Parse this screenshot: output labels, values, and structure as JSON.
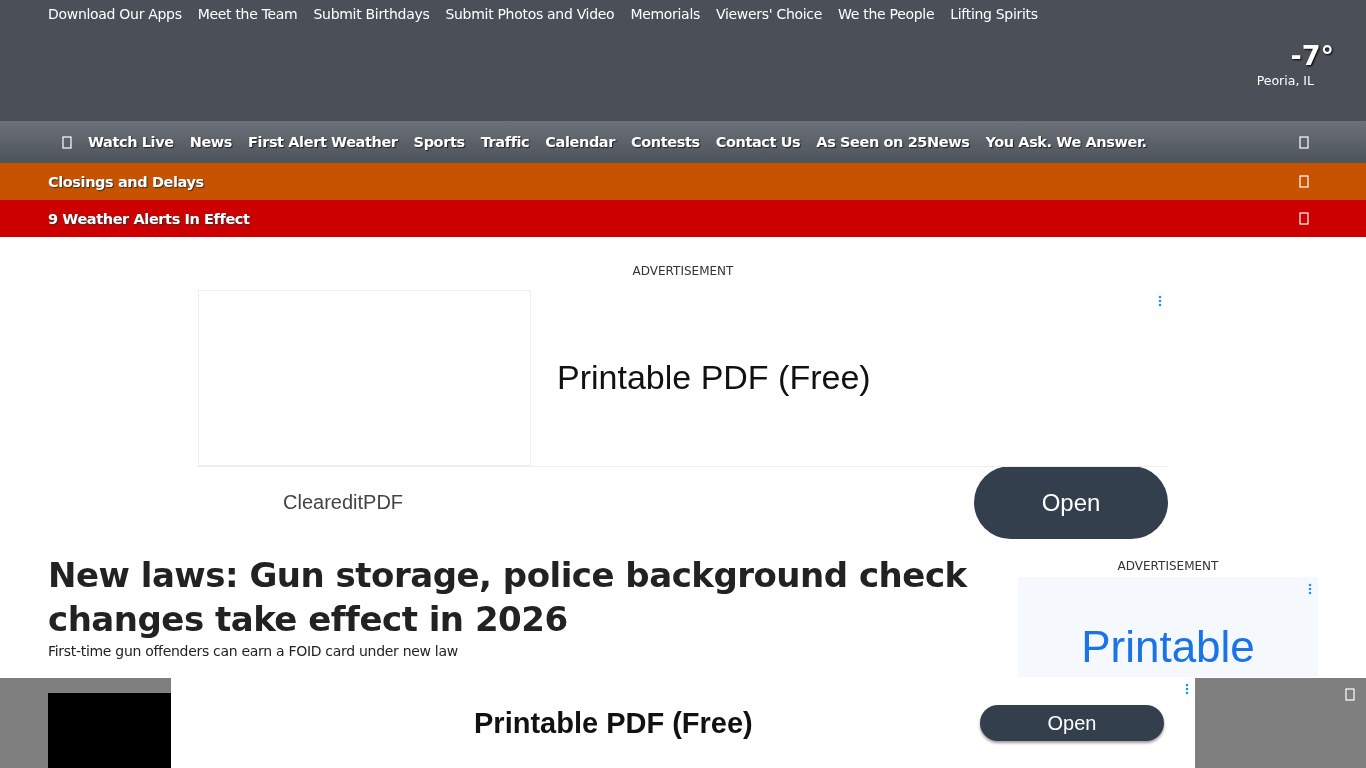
{
  "top_links": [
    "Download Our Apps",
    "Meet the Team",
    "Submit Birthdays",
    "Submit Photos and Video",
    "Memorials",
    "Viewers' Choice",
    "We the People",
    "Lifting Spirits"
  ],
  "weather": {
    "temperature": "-7°",
    "location": "Peoria, IL"
  },
  "nav": [
    "Watch Live",
    "News",
    "First Alert Weather",
    "Sports",
    "Traffic",
    "Calendar",
    "Contests",
    "Contact Us",
    "As Seen on 25News",
    "You Ask. We Answer."
  ],
  "banners": [
    {
      "text": "Closings and Delays",
      "color": "#c75300"
    },
    {
      "text": "9 Weather Alerts In Effect",
      "color": "#cc0000"
    }
  ],
  "top_ad": {
    "label": "ADVERTISEMENT",
    "headline": "Printable PDF (Free)",
    "advertiser": "CleareditPDF",
    "button": "Open"
  },
  "article": {
    "headline": "New laws: Gun storage, police background check changes take effect in 2026",
    "subheadline": "First-time gun offenders can earn a FOID card under new law"
  },
  "side_ad": {
    "label": "ADVERTISEMENT",
    "headline": "Printable"
  },
  "bottom_ad": {
    "headline": "Printable PDF (Free)",
    "button": "Open"
  }
}
